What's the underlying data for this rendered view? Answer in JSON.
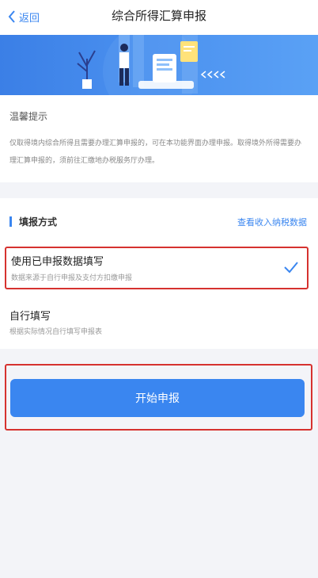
{
  "nav": {
    "back_label": "返回",
    "title": "综合所得汇算申报"
  },
  "tips": {
    "title": "温馨提示",
    "body": "仅取得境内综合所得且需要办理汇算申报的，可在本功能界面办理申报。取得境外所得需要办理汇算申报的，须前往汇缴地办税服务厅办理。"
  },
  "method": {
    "title": "填报方式",
    "link": "查看收入纳税数据",
    "options": [
      {
        "title": "使用已申报数据填写",
        "subtitle": "数据来源于自行申报及支付方扣缴申报",
        "selected": true
      },
      {
        "title": "自行填写",
        "subtitle": "根据实际情况自行填写申报表",
        "selected": false
      }
    ]
  },
  "cta": {
    "label": "开始申报"
  },
  "colors": {
    "accent": "#3a86f0",
    "highlight": "#d6322f"
  }
}
